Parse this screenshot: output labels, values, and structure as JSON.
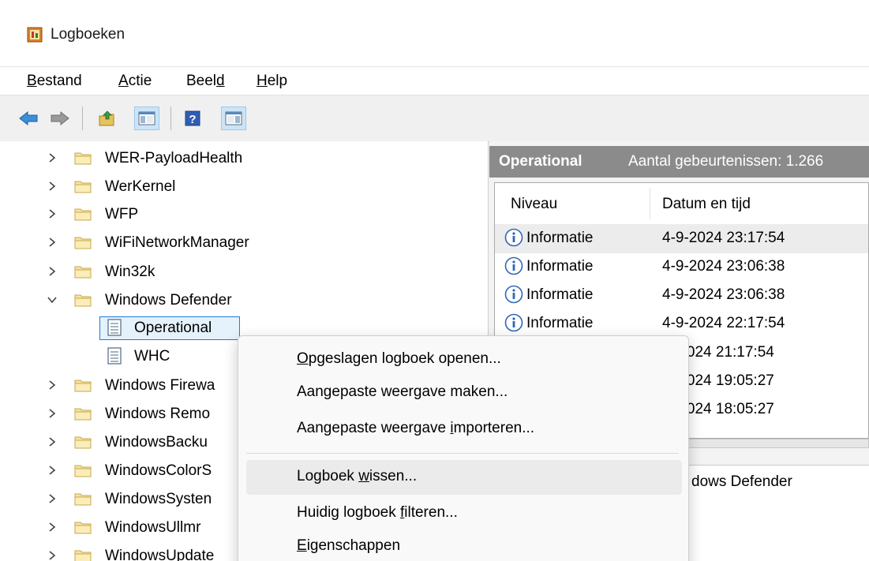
{
  "window": {
    "title": "Logboeken"
  },
  "menu": [
    {
      "pre": "",
      "key": "B",
      "post": "estand"
    },
    {
      "pre": "",
      "key": "A",
      "post": "ctie"
    },
    {
      "pre": "Beel",
      "key": "d",
      "post": ""
    },
    {
      "pre": "",
      "key": "H",
      "post": "elp"
    }
  ],
  "toolbar": {
    "buttons": [
      "back-arrow-icon",
      "forward-arrow-icon",
      "up-folder-icon",
      "show-hide-tree-icon",
      "help-icon",
      "show-hide-action-pane-icon"
    ]
  },
  "tree": {
    "items": [
      {
        "label": "WER-PayloadHealth"
      },
      {
        "label": "WerKernel"
      },
      {
        "label": "WFP"
      },
      {
        "label": "WiFiNetworkManager"
      },
      {
        "label": "Win32k"
      },
      {
        "label": "Windows Defender",
        "expanded": true
      },
      {
        "label": "Operational",
        "selected": true
      },
      {
        "label": "WHC"
      },
      {
        "label": "Windows Firewa"
      },
      {
        "label": "Windows Remo"
      },
      {
        "label": "WindowsBacku"
      },
      {
        "label": "WindowsColorS"
      },
      {
        "label": "WindowsSysten"
      },
      {
        "label": "WindowsUllmr"
      },
      {
        "label": "WindowsUpdate"
      }
    ]
  },
  "panel": {
    "title": "Operational",
    "count": "Aantal gebeurtenissen: 1.266"
  },
  "grid": {
    "columns": [
      "Niveau",
      "Datum en tijd"
    ],
    "rows": [
      {
        "level": "Informatie",
        "date": "4-9-2024 23:17:54"
      },
      {
        "level": "Informatie",
        "date": "4-9-2024 23:06:38"
      },
      {
        "level": "Informatie",
        "date": "4-9-2024 23:06:38"
      },
      {
        "level": "Informatie",
        "date": "4-9-2024 22:17:54"
      },
      {
        "level": "",
        "date": "-2024 21:17:54"
      },
      {
        "level": "",
        "date": "-2024 19:05:27"
      },
      {
        "level": "",
        "date": "-2024 18:05:27"
      }
    ]
  },
  "details": {
    "tab_text": "dows Defender"
  },
  "context_menu": {
    "items": [
      {
        "pre": "",
        "key": "O",
        "post": "pgeslagen logboek openen..."
      },
      {
        "pre": "Aangepaste weer",
        "key": "g",
        "post": "ave maken..."
      },
      {
        "pre": "Aangepaste weergave ",
        "key": "i",
        "post": "mporteren..."
      },
      {
        "pre": "Logboek ",
        "key": "w",
        "post": "issen..."
      },
      {
        "pre": "Huidig logboek ",
        "key": "f",
        "post": "ilteren..."
      },
      {
        "pre": "",
        "key": "E",
        "post": "igenschappen"
      }
    ]
  },
  "colors": {
    "accent": "#1e7bd6",
    "header_bg": "#8b8b8b",
    "menu_hover": "#ebebeb"
  }
}
